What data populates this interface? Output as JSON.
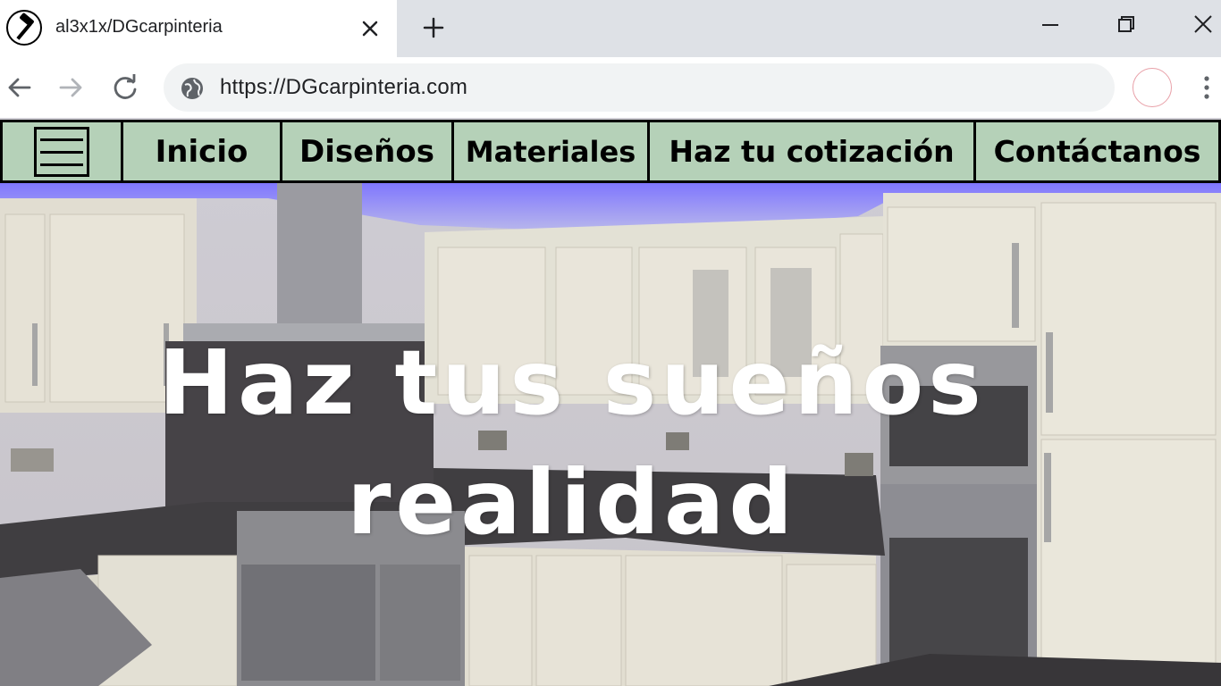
{
  "browser": {
    "tab_title": "al3x1x/DGcarpinteria",
    "url": "https://DGcarpinteria.com"
  },
  "site_nav": {
    "items": [
      {
        "label": "Inicio"
      },
      {
        "label": "Diseños"
      },
      {
        "label": "Materiales"
      },
      {
        "label": "Haz tu cotización"
      },
      {
        "label": "Contáctanos"
      }
    ]
  },
  "hero": {
    "title_line1": "Haz tus sueños",
    "title_line2": "realidad"
  },
  "colors": {
    "nav_bg": "#b5d1b8",
    "tabstrip_bg": "#dee1e6",
    "omnibox_bg": "#f1f3f4",
    "hero_text": "#ffffff"
  }
}
